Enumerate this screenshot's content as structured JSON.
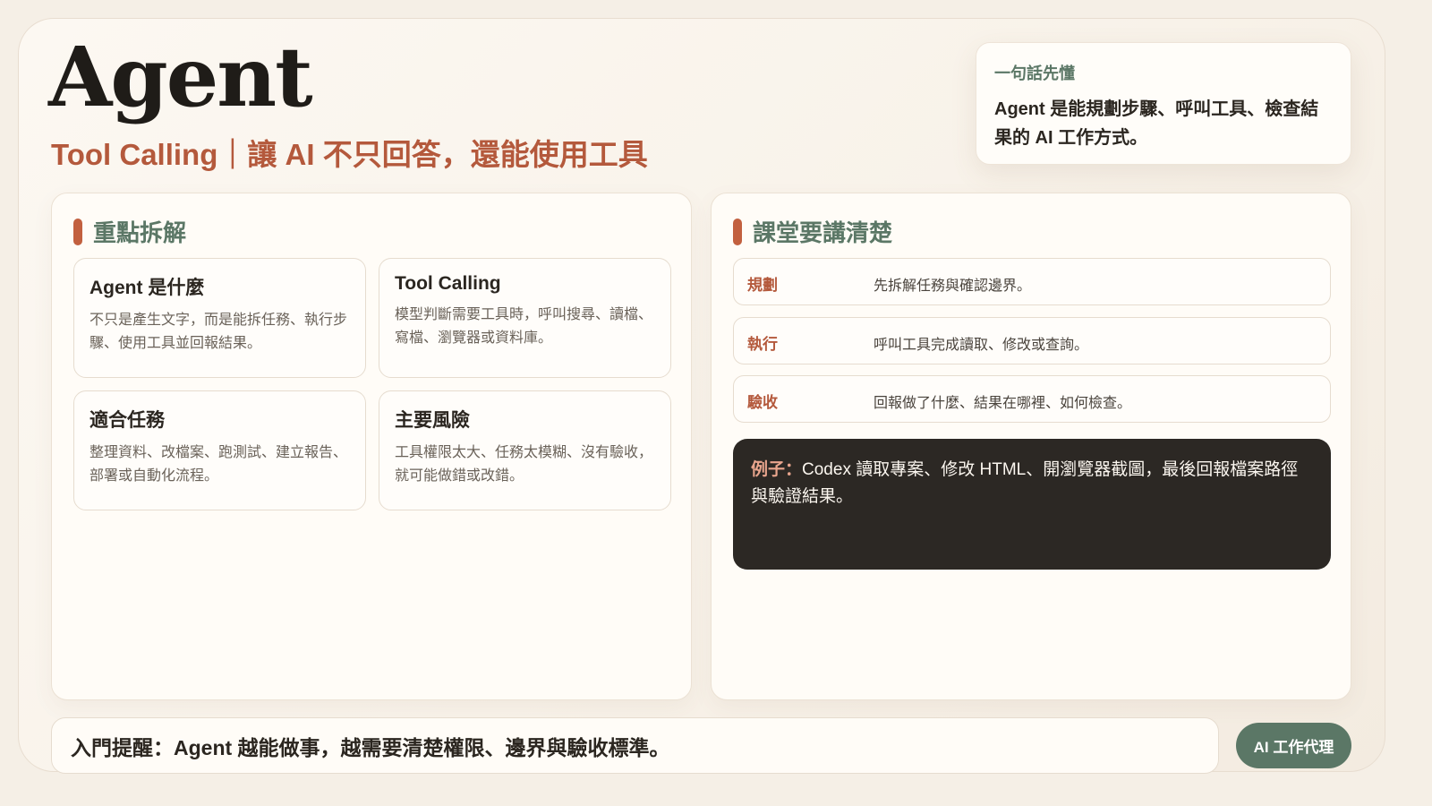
{
  "header": {
    "title": "Agent",
    "subtitle": "Tool Calling｜讓 AI 不只回答，還能使用工具"
  },
  "summary": {
    "label": "一句話先懂",
    "text": "Agent 是能規劃步驟、呼叫工具、檢查結果的 AI 工作方式。"
  },
  "left_panel": {
    "heading": "重點拆解",
    "cards": [
      {
        "title": "Agent 是什麼",
        "body": "不只是產生文字，而是能拆任務、執行步驟、使用工具並回報結果。"
      },
      {
        "title": "Tool Calling",
        "body": "模型判斷需要工具時，呼叫搜尋、讀檔、寫檔、瀏覽器或資料庫。"
      },
      {
        "title": "適合任務",
        "body": "整理資料、改檔案、跑測試、建立報告、部署或自動化流程。"
      },
      {
        "title": "主要風險",
        "body": "工具權限太大、任務太模糊、沒有驗收，就可能做錯或改錯。"
      }
    ]
  },
  "right_panel": {
    "heading": "課堂要講清楚",
    "rows": [
      {
        "key": "規劃",
        "value": "先拆解任務與確認邊界。"
      },
      {
        "key": "執行",
        "value": "呼叫工具完成讀取、修改或查詢。"
      },
      {
        "key": "驗收",
        "value": "回報做了什麼、結果在哪裡、如何檢查。"
      }
    ],
    "example": {
      "label": "例子：",
      "text": "Codex 讀取專案、修改 HTML、開瀏覽器截圖，最後回報檔案路徑與驗證結果。"
    }
  },
  "footer": {
    "reminder": "入門提醒：Agent 越能做事，越需要清楚權限、邊界與驗收標準。",
    "tag": "AI 工作代理"
  },
  "colors": {
    "accent": "#b4593c",
    "green": "#5b7766",
    "dark": "#2c2824"
  }
}
